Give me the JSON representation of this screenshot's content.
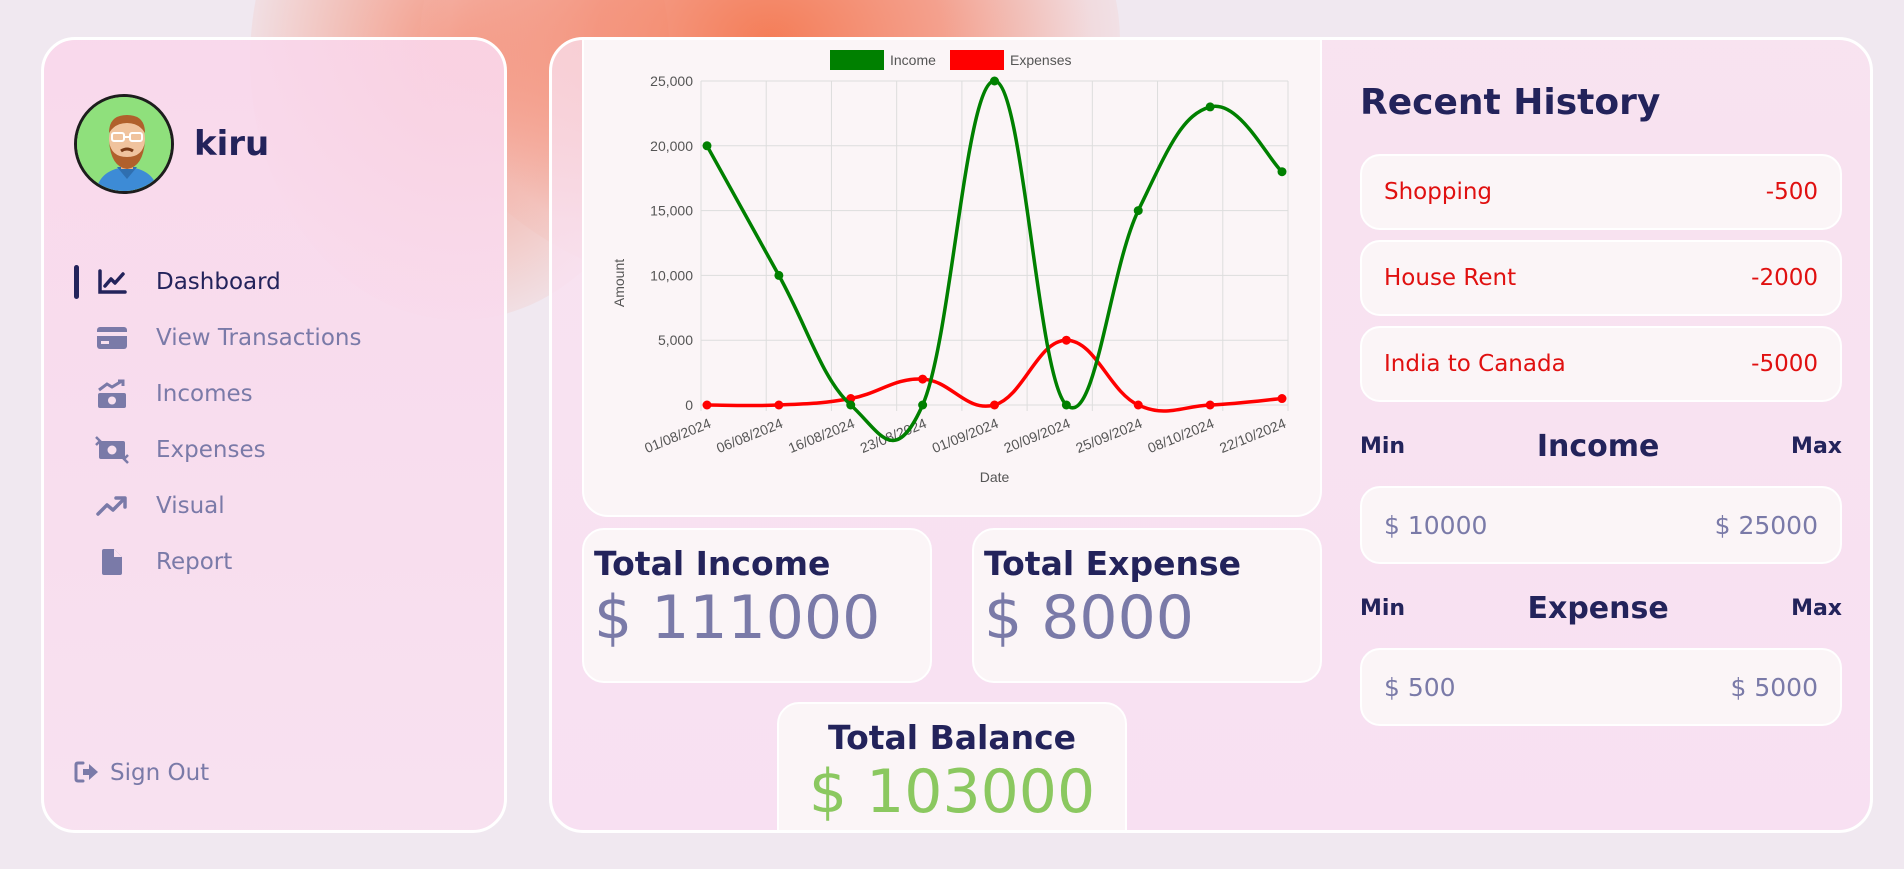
{
  "user": {
    "name": "kiru"
  },
  "nav": {
    "items": [
      {
        "label": "Dashboard",
        "icon": "chart-line-icon",
        "active": true
      },
      {
        "label": "View Transactions",
        "icon": "credit-card-icon",
        "active": false
      },
      {
        "label": "Incomes",
        "icon": "money-bill-trend-up-icon",
        "active": false
      },
      {
        "label": "Expenses",
        "icon": "money-bill-transfer-icon",
        "active": false
      },
      {
        "label": "Visual",
        "icon": "arrow-trend-up-icon",
        "active": false
      },
      {
        "label": "Report",
        "icon": "file-icon",
        "active": false
      }
    ],
    "signout": {
      "label": "Sign Out",
      "icon": "sign-out-icon"
    }
  },
  "stats": {
    "income": {
      "title": "Total Income",
      "value": "$ 111000"
    },
    "expense": {
      "title": "Total Expense",
      "value": "$ 8000"
    },
    "balance": {
      "title": "Total Balance",
      "value": "$ 103000"
    }
  },
  "history": {
    "title": "Recent History",
    "items": [
      {
        "label": "Shopping",
        "amount": "-500"
      },
      {
        "label": "House Rent",
        "amount": "-2000"
      },
      {
        "label": "India to Canada",
        "amount": "-5000"
      }
    ]
  },
  "ranges": {
    "income": {
      "min_label": "Min",
      "title": "Income",
      "max_label": "Max",
      "min": "$ 10000",
      "max": "$ 25000"
    },
    "expense": {
      "min_label": "Min",
      "title": "Expense",
      "max_label": "Max",
      "min": "$ 500",
      "max": "$ 5000"
    }
  },
  "colors": {
    "income": "#008000",
    "expense": "#ff0000",
    "navy": "#23235b",
    "muted": "#7a7aa8",
    "balance": "#8bc860"
  },
  "chart_data": {
    "type": "line",
    "categories": [
      "01/08/2024",
      "06/08/2024",
      "16/08/2024",
      "23/08/2024",
      "01/09/2024",
      "20/09/2024",
      "25/09/2024",
      "08/10/2024",
      "22/10/2024"
    ],
    "series": [
      {
        "name": "Income",
        "color": "#008000",
        "values": [
          20000,
          10000,
          0,
          0,
          25000,
          0,
          15000,
          23000,
          18000
        ]
      },
      {
        "name": "Expenses",
        "color": "#ff0000",
        "values": [
          0,
          0,
          500,
          2000,
          0,
          5000,
          0,
          0,
          500
        ]
      }
    ],
    "xlabel": "Date",
    "ylabel": "Amount",
    "ylim": [
      0,
      25000
    ],
    "yticks": [
      "0",
      "5,000",
      "10,000",
      "15,000",
      "20,000",
      "25,000"
    ],
    "grid": true,
    "legend": "top-center"
  }
}
